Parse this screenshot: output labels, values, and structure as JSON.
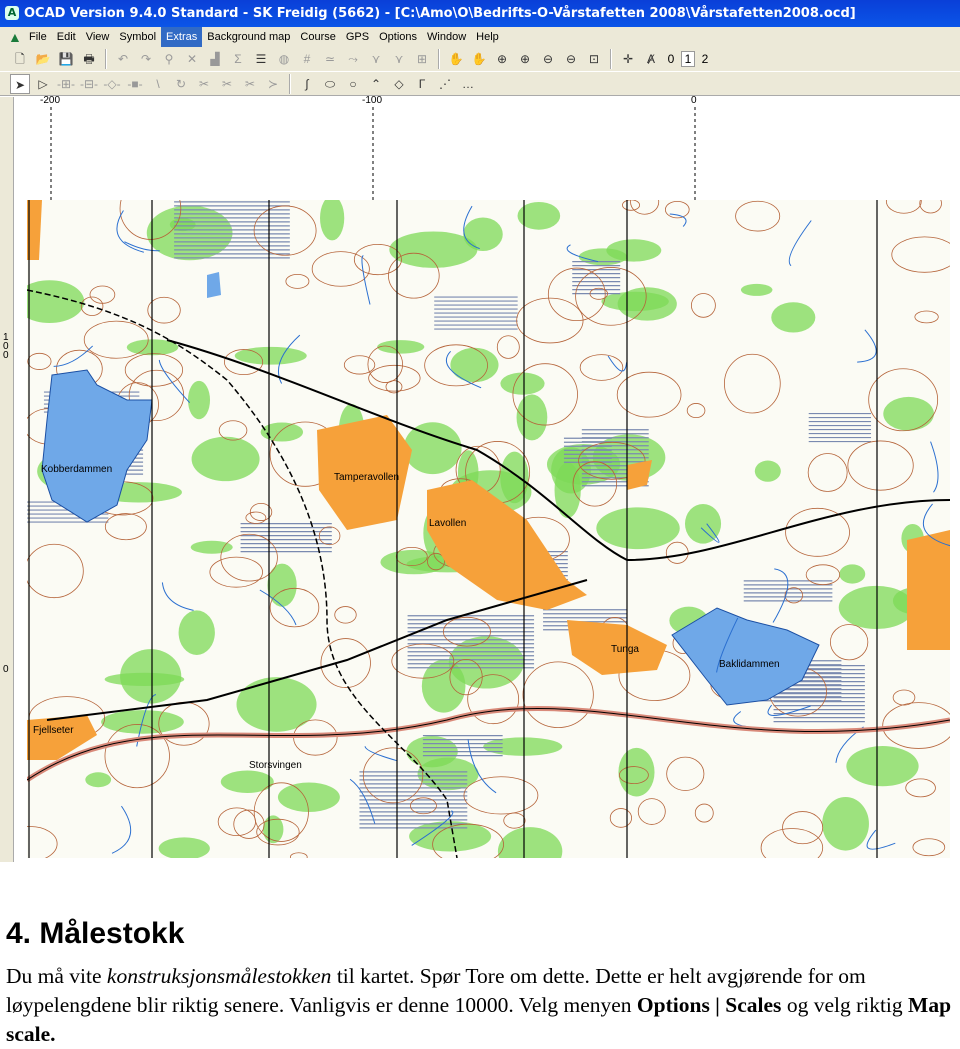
{
  "window": {
    "title": "OCAD Version 9.4.0  Standard - SK Freidig (5662) - [C:\\Amo\\O\\Bedrifts-O-Vårstafetten 2008\\Vårstafetten2008.ocd]"
  },
  "menu": [
    {
      "label": "File"
    },
    {
      "label": "Edit"
    },
    {
      "label": "View"
    },
    {
      "label": "Symbol"
    },
    {
      "label": "Extras",
      "active": true
    },
    {
      "label": "Background map"
    },
    {
      "label": "Course"
    },
    {
      "label": "GPS"
    },
    {
      "label": "Options"
    },
    {
      "label": "Window"
    },
    {
      "label": "Help"
    }
  ],
  "toolbar": {
    "levels": [
      "0",
      "1",
      "2"
    ],
    "selected_level": "1"
  },
  "ruler": {
    "top": [
      "-200",
      "-100",
      "0"
    ],
    "left": [
      "100",
      "0"
    ]
  },
  "map": {
    "labels": [
      "Kobberdammen",
      "Tamperavollen",
      "Lavollen",
      "Tunga",
      "Baklidammen",
      "Fjellseter",
      "Storsvingen"
    ],
    "colors": {
      "forest_open": "#ffffff",
      "green": "#7ed957",
      "orange": "#f6a13a",
      "water": "#6fa8e8",
      "contour": "#b5643a",
      "grid": "#000000"
    }
  },
  "doc": {
    "heading": "4. Målestokk",
    "p1": "Du må vite ",
    "p1_italic": "konstruksjonsmålestokken",
    "p2": " til kartet. Spør Tore om dette. Dette er helt avgjørende for om løypelengdene blir riktig senere. Vanligvis er denne 10000. Velg menyen ",
    "b1": "Options | Scales",
    "p3": " og velg riktig ",
    "b2": "Map scale."
  }
}
